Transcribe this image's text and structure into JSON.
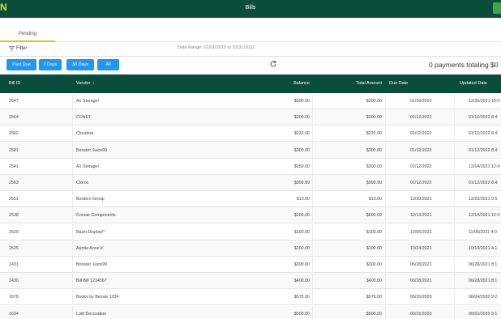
{
  "app": {
    "title": "Bills",
    "logo_glyph": "N",
    "accent": "#d6e021",
    "brand_color": "#0a4d3c",
    "action_color": "#3ea64a"
  },
  "tabs": [
    {
      "label": "Pending",
      "active": true
    }
  ],
  "filter": {
    "label": "Filter",
    "icon": "filter-icon"
  },
  "date_range": "Date Range: 01/01/2010 to 03/31/2022",
  "quick_filters": [
    "Past Due",
    "7 Days",
    "30 Days",
    "All"
  ],
  "quick_filter_color": "#2196f3",
  "summary": "0 payments totaling $0",
  "columns": {
    "bill_id": "Bill ID",
    "vendor": "Vendor",
    "balance": "Balance",
    "total": "Total Amount",
    "due": "Due Date",
    "updated": "Updated Date"
  },
  "rows": [
    {
      "id": "2647",
      "vendor": "A1 Storage!",
      "balance": "$300.00",
      "total": "$300.00",
      "due": "01/16/2022",
      "updated": "12/20/2021 10:0"
    },
    {
      "id": "2564",
      "vendor": "CCNET",
      "balance": "$300.00",
      "total": "$300.00",
      "due": "01/12/2022",
      "updated": "01/12/2022 8:4"
    },
    {
      "id": "2562",
      "vendor": "Cloudera",
      "balance": "$222.00",
      "total": "$222.00",
      "due": "01/12/2022",
      "updated": "01/12/2022 8:4"
    },
    {
      "id": "2581",
      "vendor": "Booster Juice99",
      "balance": "$300.00",
      "total": "$300.00",
      "due": "01/12/2022",
      "updated": "01/12/2022 8:4"
    },
    {
      "id": "2541",
      "vendor": "A1 Storage!",
      "balance": "$150.00",
      "total": "$300.00",
      "due": "01/12/2022",
      "updated": "12/14/2021 12:4"
    },
    {
      "id": "2563",
      "vendor": "Clorox",
      "balance": "$999.99",
      "total": "$999.99",
      "due": "01/12/2022",
      "updated": "01/12/2022 8:4"
    },
    {
      "id": "2551",
      "vendor": "Borders Group",
      "balance": "$10.00",
      "total": "$10.00",
      "due": "12/20/2021",
      "updated": "12/20/2021 9:5"
    },
    {
      "id": "2538",
      "vendor": "Corsair Components",
      "balance": "$200.00",
      "total": "$600.00",
      "due": "12/13/2021",
      "updated": "12/14/2021 12:4"
    },
    {
      "id": "2529",
      "vendor": "Bazki Display!*",
      "balance": "$100.00",
      "total": "$100.00",
      "due": "12/05/2021",
      "updated": "11/05/2021 4:0"
    },
    {
      "id": "2525",
      "vendor": "Auntie Anne's!",
      "balance": "$100.00",
      "total": "$100.00",
      "due": "10/24/2021",
      "updated": "10/14/2021 4:1"
    },
    {
      "id": "2431",
      "vendor": "Booster Juice99",
      "balance": "$300.00",
      "total": "$300.00",
      "due": "06/28/2021",
      "updated": "06/28/2021 8:1"
    },
    {
      "id": "2430",
      "vendor": "Bill Bill 1234567",
      "balance": "$400.00",
      "total": "$400.00",
      "due": "06/28/2021",
      "updated": "06/28/2021 8:1"
    },
    {
      "id": "1678",
      "vendor": "Books by Bessie 1234",
      "balance": "$575.00",
      "total": "$575.00",
      "due": "06/15/2020",
      "updated": "06/04/2020 9:2"
    },
    {
      "id": "1634",
      "vendor": "Lotti Decoration",
      "balance": "$500.00",
      "total": "$500.00",
      "due": "06/15/2020",
      "updated": "06/02/2020 9:1"
    }
  ]
}
